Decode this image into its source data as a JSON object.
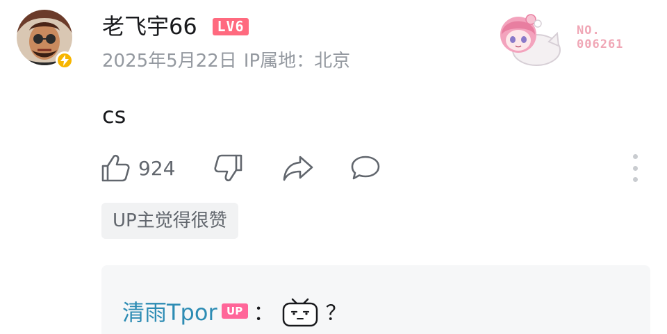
{
  "comment": {
    "username": "老飞宇66",
    "level_badge": "LV6",
    "date": "2025年5月22日",
    "ip_location": "IP属地：北京",
    "fan_number_prefix": "NO.",
    "fan_number": "006261",
    "content": "cs",
    "like_count": "924",
    "up_tag": "UP主觉得很赞"
  },
  "reply_preview": {
    "author": "清雨Tpor",
    "up_badge": "UP",
    "colon": "：",
    "text": "？",
    "emote_name": "bilibili-tv-emote"
  },
  "icons": {
    "like": "thumbs-up-icon",
    "dislike": "thumbs-down-icon",
    "share": "share-icon",
    "reply": "comment-icon",
    "more": "more-vertical-icon",
    "verified": "lightning-icon"
  },
  "colors": {
    "level_badge": "#ff6a7f",
    "up_badge": "#ff6699",
    "reply_author": "#2d8cb4",
    "meta_text": "#9499a0",
    "verified": "#f7b500"
  }
}
